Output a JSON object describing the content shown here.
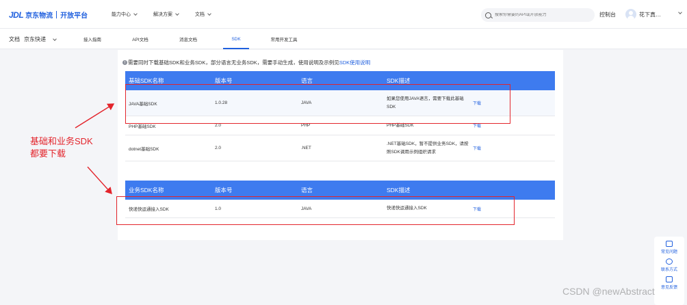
{
  "header": {
    "logo_jdl": "JDL",
    "logo_brand": "京东物流",
    "logo_platform": "开放平台",
    "nav": [
      {
        "label": "能力中心"
      },
      {
        "label": "解决方案"
      },
      {
        "label": "文档"
      }
    ],
    "search_placeholder": "搜索你需要的API或开放能力",
    "console": "控制台",
    "username": "花下真…"
  },
  "subnav": {
    "breadcrumb_root": "文档",
    "breadcrumb_current": "京东快递",
    "tabs": [
      {
        "label": "接入指南",
        "active": false
      },
      {
        "label": "API文档",
        "active": false
      },
      {
        "label": "消息文档",
        "active": false
      },
      {
        "label": "SDK",
        "active": true
      },
      {
        "label": "常用开发工具",
        "active": false
      }
    ]
  },
  "notice": {
    "icon": "info-icon",
    "text": "需要同时下载基础SDK和业务SDK，部分语言无业务SDK，需要手动生成，使用说明及示例见",
    "link": "SDK使用说明"
  },
  "base_table": {
    "headers": [
      "基础SDK名称",
      "版本号",
      "语言",
      "SDK描述"
    ],
    "rows": [
      {
        "name": "JAVA基础SDK",
        "version": "1.0.28",
        "lang": "JAVA",
        "desc": "如果您使用JAVA语言，需要下载此基础SDK",
        "action": "下载"
      },
      {
        "name": "PHP基础SDK",
        "version": "2.0",
        "lang": "PHP",
        "desc": "PHP基础SDK",
        "action": "下载"
      },
      {
        "name": "dotnet基础SDK",
        "version": "2.0",
        "lang": ".NET",
        "desc": ".NET基础SDK，暂不提供业务SDK，请按照SDK调用示例组织请求",
        "action": "下载"
      }
    ]
  },
  "biz_table": {
    "headers": [
      "业务SDK名称",
      "版本号",
      "语言",
      "SDK描述"
    ],
    "rows": [
      {
        "name": "快递快运通接入SDK",
        "version": "1.0",
        "lang": "JAVA",
        "desc": "快递快运通接入SDK",
        "action": "下载"
      }
    ]
  },
  "annotation": {
    "line1": "基础和业务SDK",
    "line2": "都要下载",
    "color": "#e3242b"
  },
  "float_panel": [
    {
      "icon": "faq-icon",
      "label": "常见问题"
    },
    {
      "icon": "contact-icon",
      "label": "联系方式"
    },
    {
      "icon": "feedback-icon",
      "label": "意见反馈"
    }
  ],
  "watermark": "CSDN @newAbstract",
  "colors": {
    "primary": "#1f5fde",
    "table_header": "#3e7bef",
    "annotation": "#e3242b"
  }
}
